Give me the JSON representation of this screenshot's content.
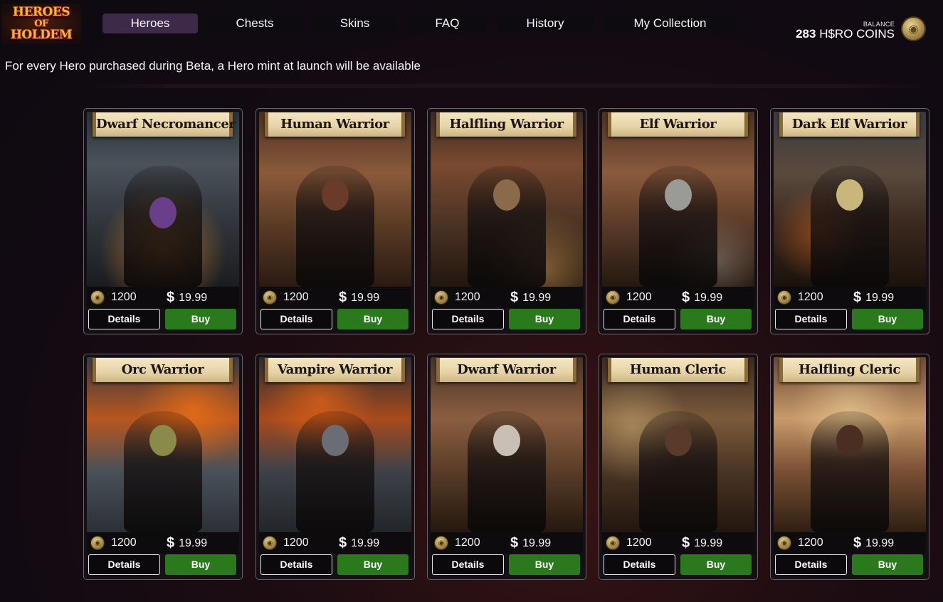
{
  "logo": {
    "line1": "HEROES",
    "line2": "OF",
    "line3": "HOLDEM"
  },
  "nav": {
    "tabs": [
      {
        "label": "Heroes",
        "active": true
      },
      {
        "label": "Chests",
        "active": false
      },
      {
        "label": "Skins",
        "active": false
      },
      {
        "label": "FAQ",
        "active": false
      },
      {
        "label": "History",
        "active": false
      },
      {
        "label": "My Collection",
        "active": false
      }
    ]
  },
  "balance": {
    "label": "BALANCE",
    "amount": "283",
    "currency": "H$RO COINS",
    "icon": "coin-icon"
  },
  "notice": "For every Hero purchased during Beta, a Hero mint at launch will be available",
  "buttons": {
    "details": "Details",
    "buy": "Buy"
  },
  "colors": {
    "buy_green": "#2a7a1d",
    "active_tab": "#3c2a48"
  },
  "heroes": [
    {
      "name": "Dwarf Necromancer",
      "coin_price": "1200",
      "usd_price": "19.99",
      "dollar": "$"
    },
    {
      "name": "Human Warrior",
      "coin_price": "1200",
      "usd_price": "19.99",
      "dollar": "$"
    },
    {
      "name": "Halfling Warrior",
      "coin_price": "1200",
      "usd_price": "19.99",
      "dollar": "$"
    },
    {
      "name": "Elf Warrior",
      "coin_price": "1200",
      "usd_price": "19.99",
      "dollar": "$"
    },
    {
      "name": "Dark Elf Warrior",
      "coin_price": "1200",
      "usd_price": "19.99",
      "dollar": "$"
    },
    {
      "name": "Orc Warrior",
      "coin_price": "1200",
      "usd_price": "19.99",
      "dollar": "$"
    },
    {
      "name": "Vampire Warrior",
      "coin_price": "1200",
      "usd_price": "19.99",
      "dollar": "$"
    },
    {
      "name": "Dwarf Warrior",
      "coin_price": "1200",
      "usd_price": "19.99",
      "dollar": "$"
    },
    {
      "name": "Human Cleric",
      "coin_price": "1200",
      "usd_price": "19.99",
      "dollar": "$"
    },
    {
      "name": "Halfling Cleric",
      "coin_price": "1200",
      "usd_price": "19.99",
      "dollar": "$"
    }
  ]
}
